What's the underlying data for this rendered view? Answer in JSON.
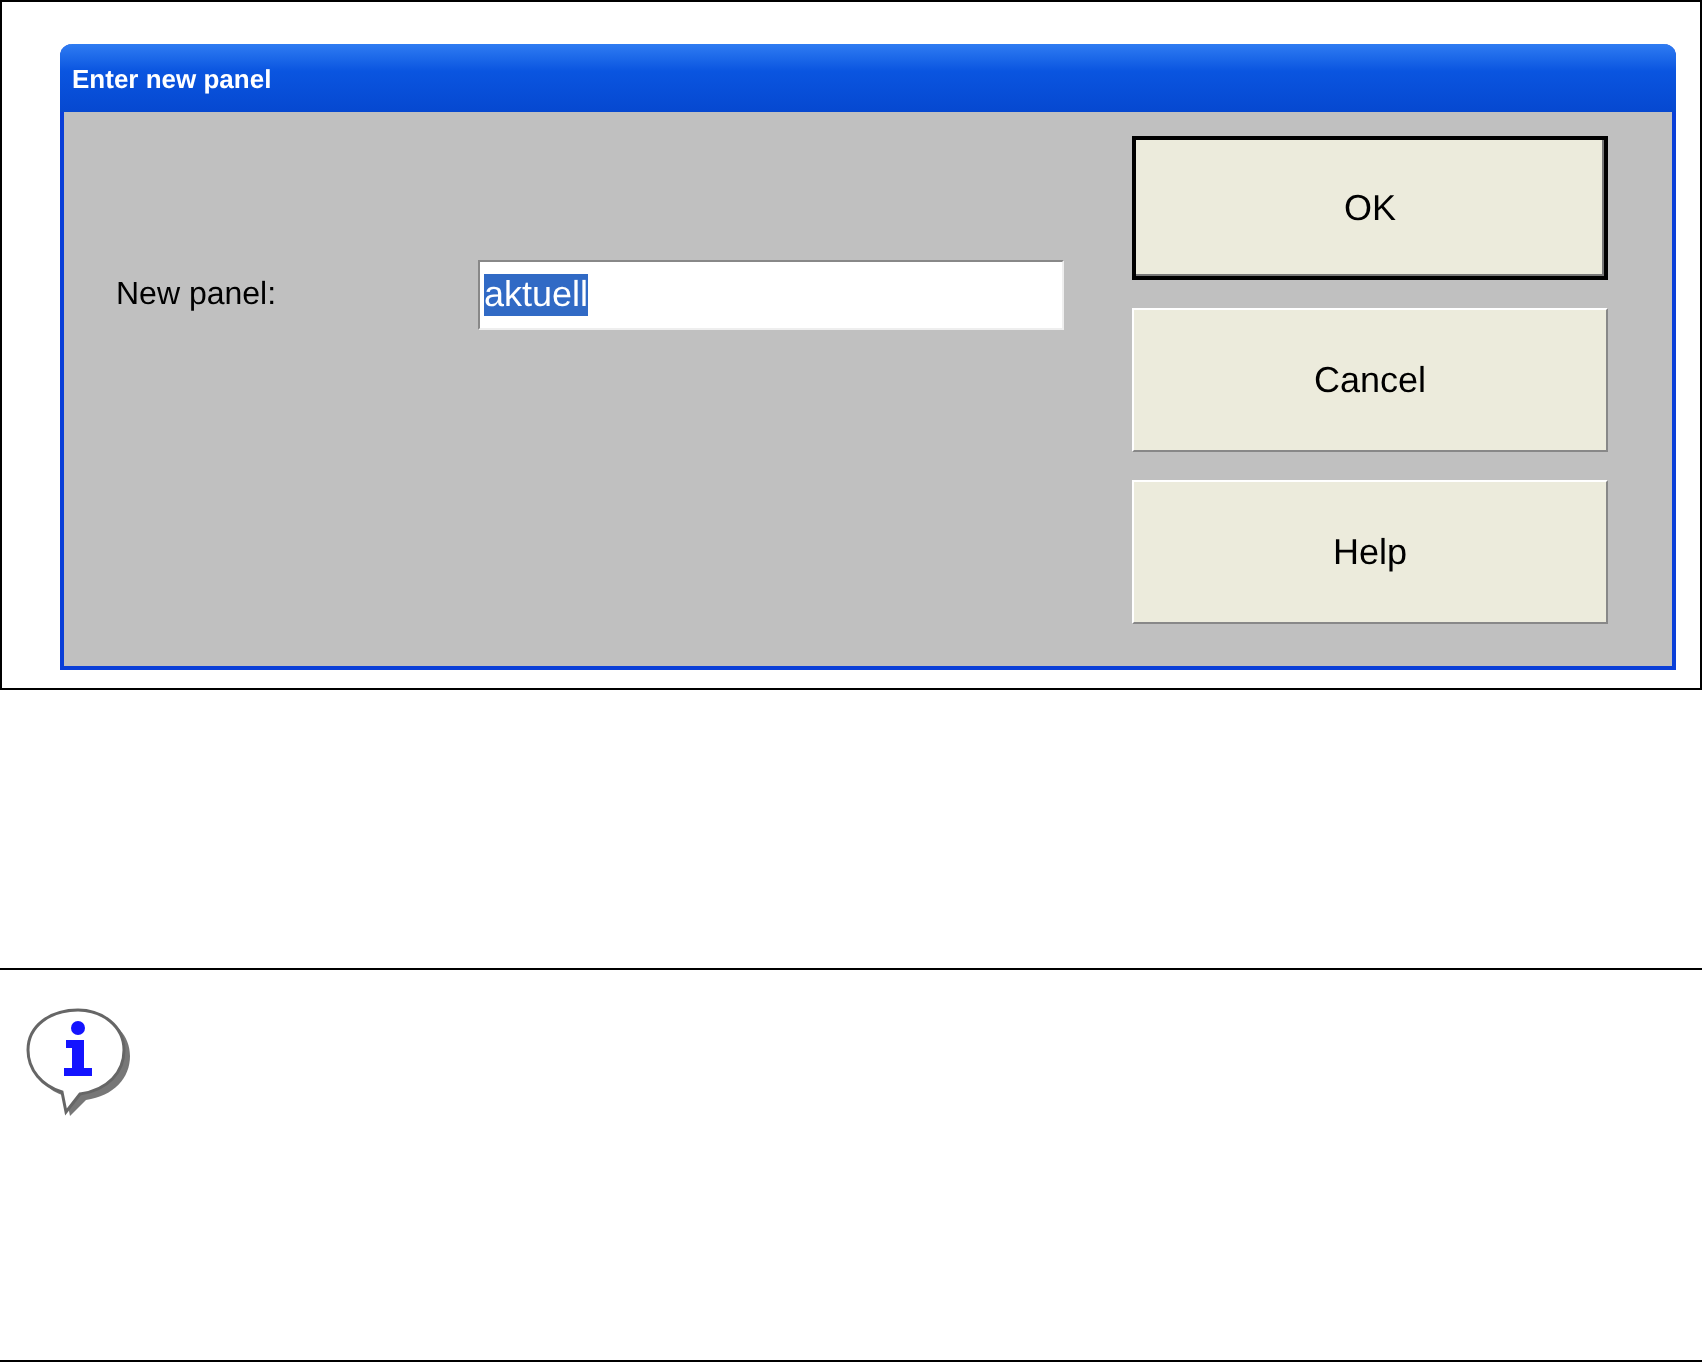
{
  "dialog": {
    "title": "Enter new panel",
    "field": {
      "label": "New panel:",
      "value": "aktuell",
      "text_selected": true
    },
    "buttons": [
      {
        "label": "OK",
        "default": true
      },
      {
        "label": "Cancel",
        "default": false
      },
      {
        "label": "Help",
        "default": false
      }
    ]
  },
  "note": {
    "kind": "info"
  }
}
